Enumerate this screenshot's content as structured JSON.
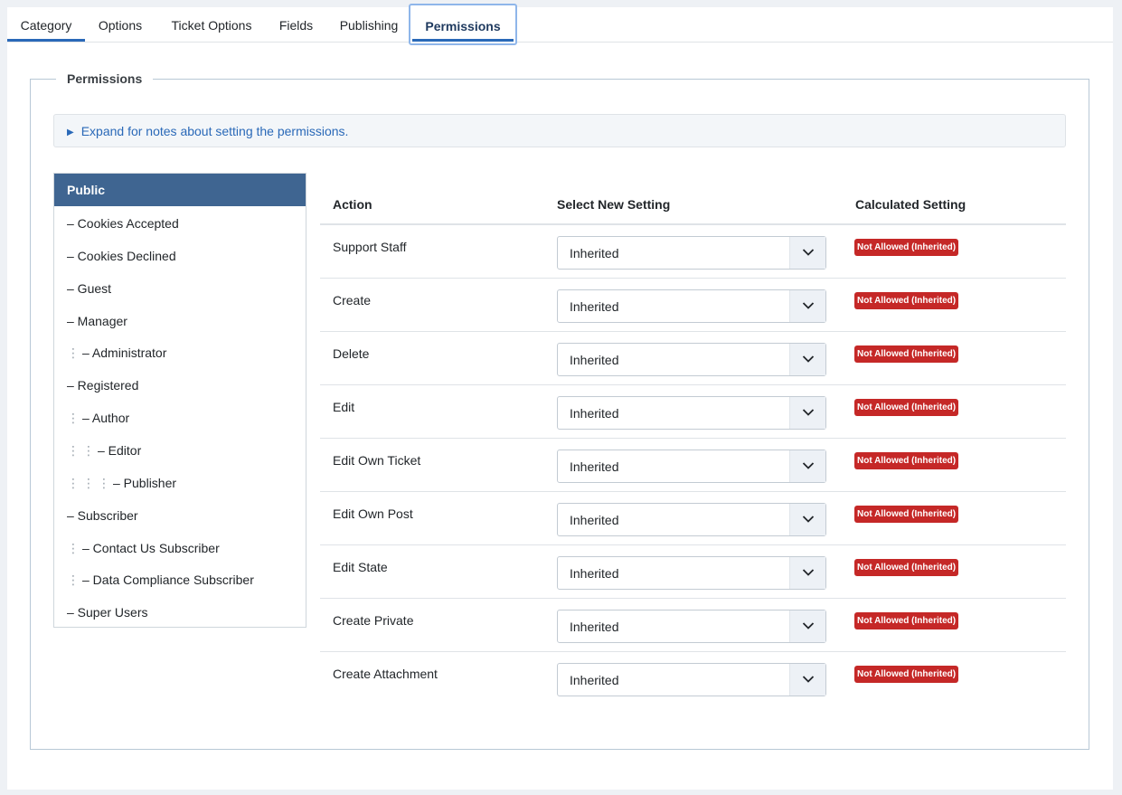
{
  "tabs": [
    {
      "label": "Category"
    },
    {
      "label": "Options"
    },
    {
      "label": "Ticket Options"
    },
    {
      "label": "Fields"
    },
    {
      "label": "Publishing"
    },
    {
      "label": "Permissions"
    }
  ],
  "fieldset": {
    "legend": "Permissions"
  },
  "notes": {
    "label": "Expand for notes about setting the permissions."
  },
  "groups": [
    {
      "label": "Public",
      "depth": 0
    },
    {
      "label": "– Cookies Accepted",
      "depth": 0
    },
    {
      "label": "– Cookies Declined",
      "depth": 0
    },
    {
      "label": "– Guest",
      "depth": 0
    },
    {
      "label": "– Manager",
      "depth": 0
    },
    {
      "label": "– Administrator",
      "depth": 1
    },
    {
      "label": "– Registered",
      "depth": 0
    },
    {
      "label": "– Author",
      "depth": 1
    },
    {
      "label": "– Editor",
      "depth": 2
    },
    {
      "label": "– Publisher",
      "depth": 3
    },
    {
      "label": "– Subscriber",
      "depth": 0
    },
    {
      "label": "– Contact Us Subscriber",
      "depth": 1
    },
    {
      "label": "– Data Compliance Subscriber",
      "depth": 1
    },
    {
      "label": "– Super Users",
      "depth": 0
    }
  ],
  "table": {
    "headers": {
      "action": "Action",
      "select": "Select New Setting",
      "calculated": "Calculated Setting"
    },
    "rows": [
      {
        "action": "Support Staff",
        "setting": "Inherited",
        "calculated": "Not Allowed (Inherited)"
      },
      {
        "action": "Create",
        "setting": "Inherited",
        "calculated": "Not Allowed (Inherited)"
      },
      {
        "action": "Delete",
        "setting": "Inherited",
        "calculated": "Not Allowed (Inherited)"
      },
      {
        "action": "Edit",
        "setting": "Inherited",
        "calculated": "Not Allowed (Inherited)"
      },
      {
        "action": "Edit Own Ticket",
        "setting": "Inherited",
        "calculated": "Not Allowed (Inherited)"
      },
      {
        "action": "Edit Own Post",
        "setting": "Inherited",
        "calculated": "Not Allowed (Inherited)"
      },
      {
        "action": "Edit State",
        "setting": "Inherited",
        "calculated": "Not Allowed (Inherited)"
      },
      {
        "action": "Create Private",
        "setting": "Inherited",
        "calculated": "Not Allowed (Inherited)"
      },
      {
        "action": "Create Attachment",
        "setting": "Inherited",
        "calculated": "Not Allowed (Inherited)"
      }
    ]
  },
  "colors": {
    "accent": "#2a69b8",
    "active_group": "#3f6591",
    "badge_danger": "#c52827"
  },
  "icons": {
    "notes_toggle": "caret-right-icon",
    "select_arrow": "chevron-down-icon",
    "tree_guide": "vertical-dots-icon"
  }
}
